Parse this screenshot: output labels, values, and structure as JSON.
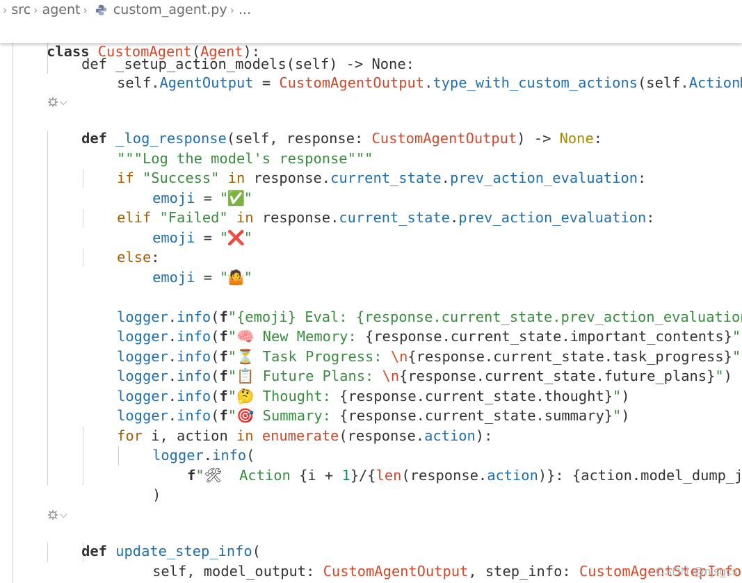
{
  "breadcrumb": {
    "items": [
      "src",
      "agent",
      "custom_agent.py",
      "..."
    ]
  },
  "sticky": {
    "class_kw": "class",
    "class_name": "CustomAgent",
    "open": "(",
    "base": "Agent",
    "close": "):"
  },
  "code": {
    "setup_fragment": "def _setup_action_models(self) -> None:",
    "l_setup_self": "self",
    "l_setup_attr": "AgentOutput",
    "l_setup_eq": " = ",
    "l_setup_cls": "CustomAgentOutput",
    "l_setup_method": "type_with_custom_actions",
    "l_setup_arg": "(self.",
    "l_setup_tail": "ActionMo",
    "def_kw": "def",
    "log_fn": "_log_response",
    "log_params": "(self, response: ",
    "log_type": "CustomAgentOutput",
    "log_arrow": ") -> ",
    "none": "None",
    "colon": ":",
    "docstring": "\"\"\"Log the model's response\"\"\"",
    "if_kw": "if",
    "elif_kw": "elif",
    "else_kw": "else",
    "in_kw": "in",
    "success_str": "\"Success\"",
    "failed_str": "\"Failed\"",
    "response": "response",
    "current_state": "current_state",
    "prev_action_evaluation": "prev_action_evaluation",
    "emoji_var": "emoji",
    "eq": " = ",
    "emoji_check": "\"✅\"",
    "emoji_cross": "\"❌\"",
    "emoji_shrug": "\"🤷\"",
    "logger": "logger",
    "info": "info",
    "f": "f",
    "log1_text": "\"{emoji} Eval: {response.current_state.prev_action_evaluation}",
    "log2_emoji": "🧠",
    "log2_text": " New Memory: ",
    "log2_expr": "{response.current_state.important_contents}",
    "log3_emoji": "⏳",
    "log3_text": " Task Progress: ",
    "log3_nl": "\\n",
    "log3_expr": "{response.current_state.task_progress}",
    "log4_emoji": "📋",
    "log4_text": " Future Plans: ",
    "log4_nl": "\\n",
    "log4_expr": "{response.current_state.future_plans}",
    "log5_emoji": "🤔",
    "log5_text": " Thought: ",
    "log5_expr": "{response.current_state.thought}",
    "log6_emoji": "🎯",
    "log6_text": " Summary: ",
    "log6_expr": "{response.current_state.summary}",
    "for_kw": "for",
    "for_vars": " i, action ",
    "enumerate": "enumerate",
    "action": "action",
    "act_emoji": "🛠",
    "act_text": "  Action ",
    "act_i": "{i + ",
    "act_one": "1",
    "act_rest": "}/{",
    "len_fn": "len",
    "act_resp": "(response.",
    "act_action": "action",
    "act_close": ")}: {action.model_dump_jso",
    "close_paren": ")",
    "update_fn": "update_step_info",
    "update_open": "(",
    "update_params": "self, model_output: ",
    "update_type1": "CustomAgentOutput",
    "update_step": ", step_info: ",
    "update_type2": "CustomAgentStepInfo",
    "update_eq": " =",
    "update_close": "):"
  },
  "watermark": "CSDN @njsgcs",
  "colors": {
    "keyword": "#a65f00",
    "class": "#d1492b",
    "function": "#1f6fb3",
    "string": "#398d3e"
  }
}
